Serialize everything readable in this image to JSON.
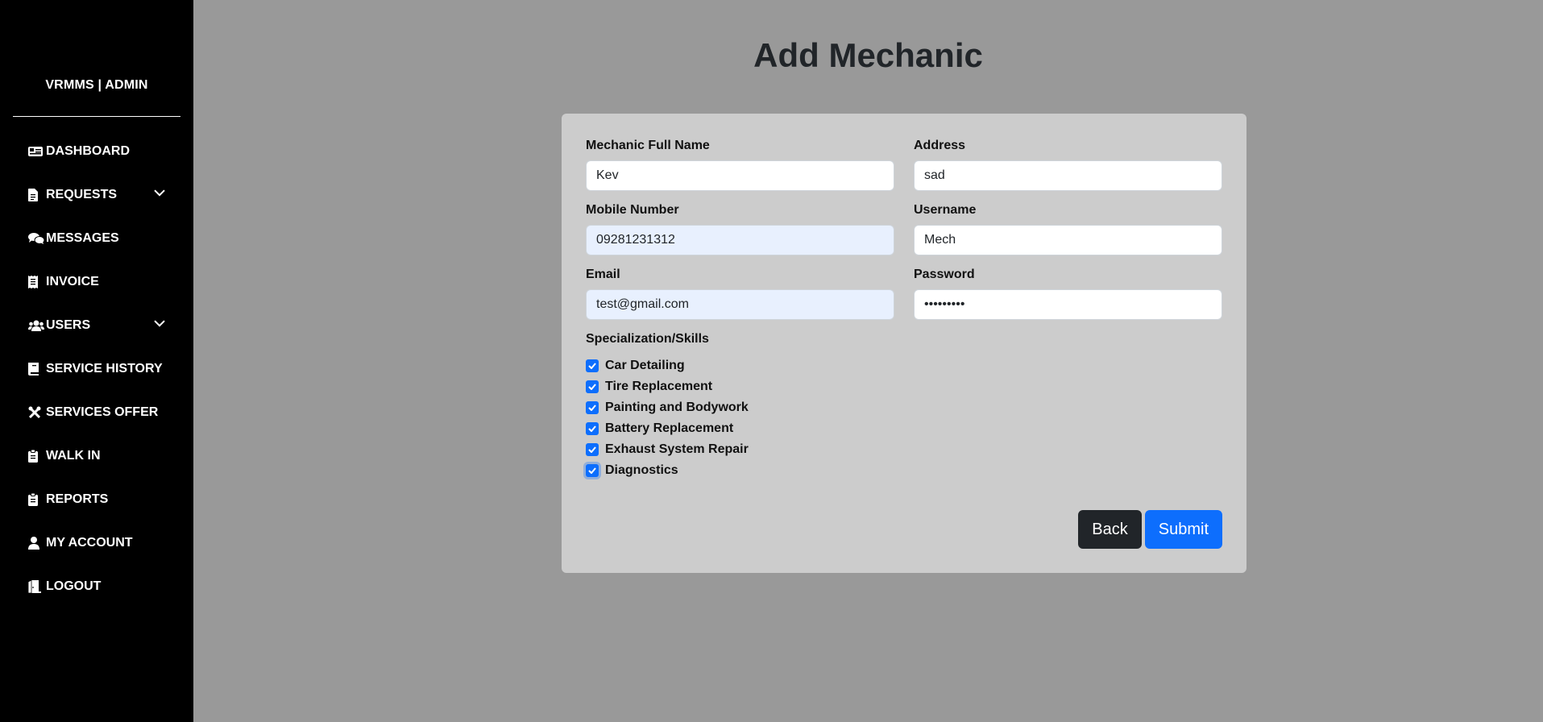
{
  "sidebar": {
    "brand": "VRMMS | ADMIN",
    "items": [
      {
        "label": "DASHBOARD",
        "icon": "dashboard-icon"
      },
      {
        "label": "REQUESTS",
        "icon": "file-icon",
        "has_dropdown": true
      },
      {
        "label": "MESSAGES",
        "icon": "comments-icon"
      },
      {
        "label": "INVOICE",
        "icon": "receipt-icon"
      },
      {
        "label": "USERS",
        "icon": "users-icon",
        "has_dropdown": true
      },
      {
        "label": "SERVICE HISTORY",
        "icon": "book-icon"
      },
      {
        "label": "SERVICES OFFER",
        "icon": "tools-icon"
      },
      {
        "label": "WALK IN",
        "icon": "clipboard-icon"
      },
      {
        "label": "REPORTS",
        "icon": "clipboard-icon"
      },
      {
        "label": "MY ACCOUNT",
        "icon": "user-icon"
      },
      {
        "label": "LOGOUT",
        "icon": "door-icon"
      }
    ]
  },
  "main": {
    "title": "Add Mechanic"
  },
  "form": {
    "full_name": {
      "label": "Mechanic Full Name",
      "value": "Kev"
    },
    "address": {
      "label": "Address",
      "value": "sad"
    },
    "mobile": {
      "label": "Mobile Number",
      "value": "09281231312"
    },
    "username": {
      "label": "Username",
      "value": "Mech"
    },
    "email": {
      "label": "Email",
      "value": "test@gmail.com"
    },
    "password": {
      "label": "Password",
      "value": "•••••••••"
    },
    "skills_label": "Specialization/Skills",
    "skills": [
      {
        "label": "Car Detailing",
        "checked": true
      },
      {
        "label": "Tire Replacement",
        "checked": true
      },
      {
        "label": "Painting and Bodywork",
        "checked": true
      },
      {
        "label": "Battery Replacement",
        "checked": true
      },
      {
        "label": "Exhaust System Repair",
        "checked": true
      },
      {
        "label": "Diagnostics",
        "checked": true
      }
    ],
    "back_label": "Back",
    "submit_label": "Submit"
  },
  "colors": {
    "sidebar_bg": "#000000",
    "page_bg": "#999999",
    "card_bg": "#cccccc",
    "primary": "#0d6efd",
    "dark": "#212529",
    "autofill_bg": "#e8f0fe"
  }
}
